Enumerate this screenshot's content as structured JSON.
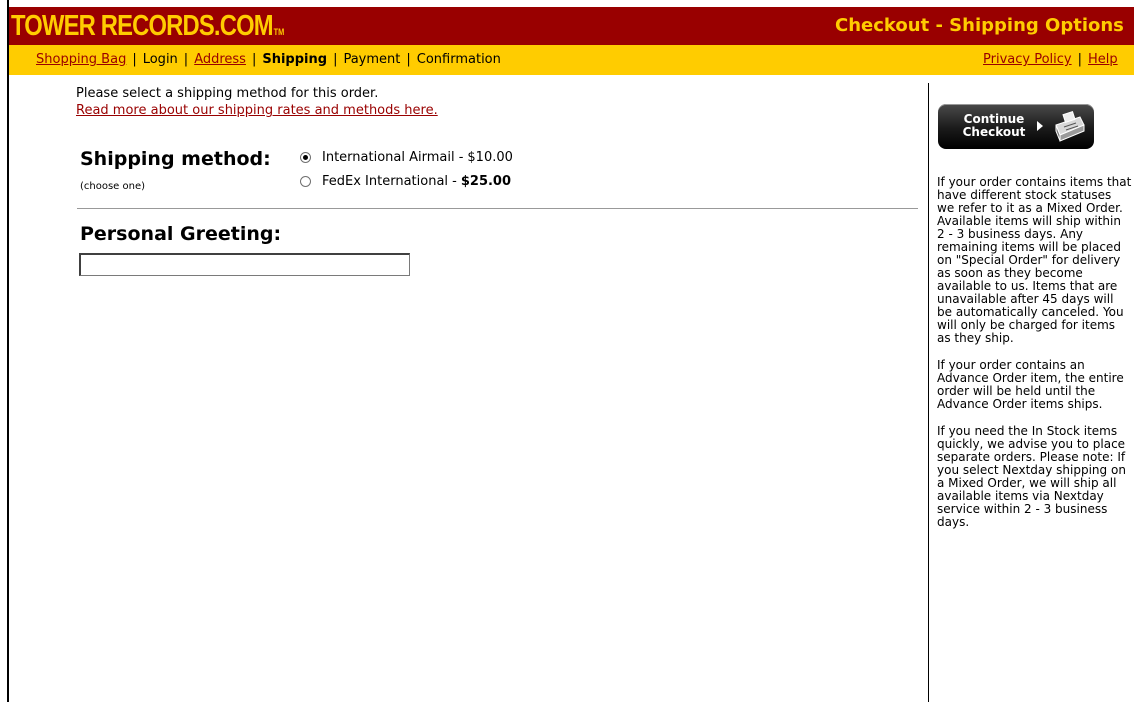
{
  "header": {
    "logo_text": "TOWER RECORDS.COM",
    "logo_tm": "TM",
    "page_title": "Checkout - Shipping Options",
    "colors": {
      "bar": "#990000",
      "accent": "#ffcc00",
      "link": "#990000"
    }
  },
  "nav": {
    "steps": [
      {
        "label": "Shopping Bag",
        "link": true
      },
      {
        "label": "Login",
        "link": false
      },
      {
        "label": "Address",
        "link": true
      },
      {
        "label": "Shipping",
        "link": false,
        "current": true
      },
      {
        "label": "Payment",
        "link": false
      },
      {
        "label": "Confirmation",
        "link": false
      }
    ],
    "separator": "|",
    "right_links": [
      "Privacy Policy",
      "Help"
    ]
  },
  "main": {
    "intro_text": "Please select a shipping method for this order.",
    "rates_link": "Read more about our shipping rates and methods here.",
    "shipping_label": "Shipping method:",
    "shipping_hint": "(choose one)",
    "options": [
      {
        "label": "International Airmail -",
        "price": "$10.00",
        "selected": true
      },
      {
        "label": "FedEx International -",
        "price": "$25.00",
        "selected": false
      }
    ],
    "greeting_label": "Personal Greeting:",
    "greeting_value": ""
  },
  "sidebar": {
    "button_line1": "Continue",
    "button_line2": "Checkout",
    "button_icon": "cash-register-icon",
    "paragraphs": [
      "If your order contains items that have different stock statuses we refer to it as a Mixed Order. Available items will ship within 2 - 3 business days. Any remaining items will be placed on \"Special Order\" for delivery as soon as they become available to us. Items that are unavailable after 45 days will be automatically canceled. You will only be charged for items as they ship.",
      "If your order contains an Advance Order item, the entire order will be held until the Advance Order items ships.",
      "If you need the In Stock items quickly, we advise you to place separate orders. Please note: If you select Nextday shipping on a Mixed Order, we will ship all available items via Nextday service within 2 - 3 business days."
    ]
  }
}
